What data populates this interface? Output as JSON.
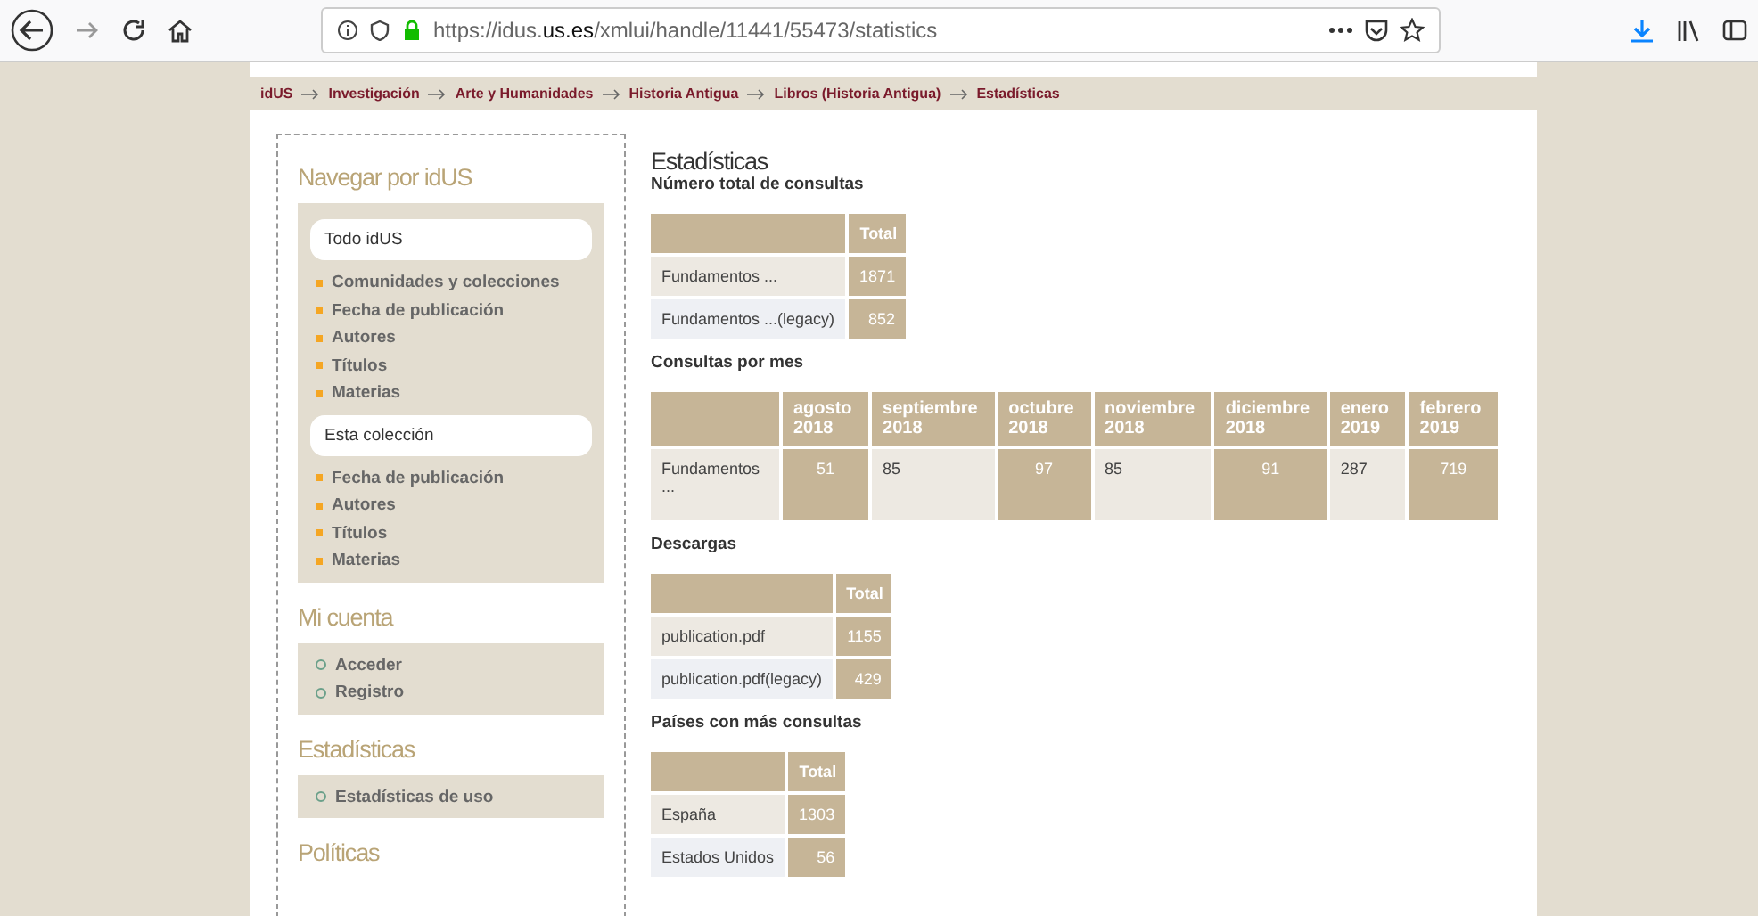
{
  "browser": {
    "url": "https://idus.**us.es**/xmlui/handle/11441/55473/statistics"
  },
  "breadcrumb": [
    "idUS",
    "Investigación",
    "Arte y Humanidades",
    "Historia Antigua",
    "Libros (Historia Antigua)",
    "Estadísticas"
  ],
  "sidebar": {
    "sections": [
      {
        "title": "Navegar por idUS",
        "kind": "square",
        "groups": [
          {
            "heading": "Todo idUS",
            "items": [
              "Comunidades y colecciones",
              "Fecha de publicación",
              "Autores",
              "Títulos",
              "Materias"
            ]
          },
          {
            "heading": "Esta colección",
            "items": [
              "Fecha de publicación",
              "Autores",
              "Títulos",
              "Materias"
            ]
          }
        ]
      },
      {
        "title": "Mi cuenta",
        "kind": "circle",
        "groups": [
          {
            "items": [
              "Acceder",
              "Registro"
            ]
          }
        ]
      },
      {
        "title": "Estadísticas",
        "kind": "circle",
        "groups": [
          {
            "items": [
              "Estadísticas de uso"
            ]
          }
        ]
      },
      {
        "title": "Políticas"
      }
    ]
  },
  "content": {
    "title": "Estadísticas",
    "tables": [
      {
        "heading": "Número total de consultas",
        "columns": [
          "Total"
        ],
        "rows": [
          {
            "label": "Fundamentos ...",
            "values": [
              "1871"
            ]
          },
          {
            "label": "Fundamentos ...(legacy)",
            "values": [
              "852"
            ]
          }
        ]
      },
      {
        "heading": "Consultas por mes",
        "columns": [
          "agosto 2018",
          "septiembre 2018",
          "octubre 2018",
          "noviembre 2018",
          "diciembre 2018",
          "enero 2019",
          "febrero 2019"
        ],
        "rows": [
          {
            "label": "Fundamentos ...",
            "values": [
              "51",
              "85",
              "97",
              "85",
              "91",
              "287",
              "719"
            ]
          }
        ]
      },
      {
        "heading": "Descargas",
        "columns": [
          "Total"
        ],
        "rows": [
          {
            "label": "publication.pdf",
            "values": [
              "1155"
            ]
          },
          {
            "label": "publication.pdf(legacy)",
            "values": [
              "429"
            ]
          }
        ]
      },
      {
        "heading": "Países con más consultas",
        "columns": [
          "Total"
        ],
        "rows": [
          {
            "label": "España",
            "values": [
              "1303"
            ]
          },
          {
            "label": "Estados Unidos",
            "values": [
              "56"
            ]
          }
        ]
      }
    ]
  }
}
